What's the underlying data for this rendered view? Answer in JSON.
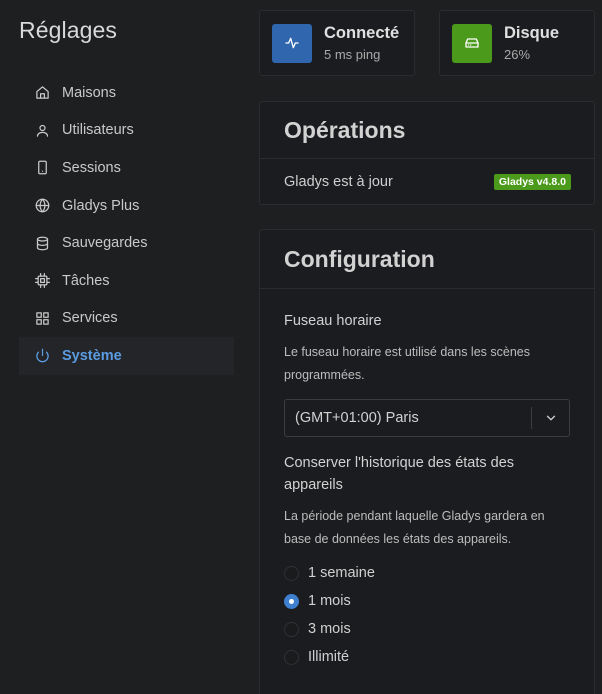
{
  "sidebar": {
    "title": "Réglages",
    "items": [
      {
        "label": "Maisons",
        "icon": "home-icon"
      },
      {
        "label": "Utilisateurs",
        "icon": "user-icon"
      },
      {
        "label": "Sessions",
        "icon": "smartphone-icon"
      },
      {
        "label": "Gladys Plus",
        "icon": "globe-icon"
      },
      {
        "label": "Sauvegardes",
        "icon": "database-icon"
      },
      {
        "label": "Tâches",
        "icon": "cpu-icon"
      },
      {
        "label": "Services",
        "icon": "grid-icon"
      },
      {
        "label": "Système",
        "icon": "power-icon",
        "active": true
      }
    ]
  },
  "stats": {
    "connection": {
      "title": "Connecté",
      "subtitle": "5 ms ping",
      "color": "#2f66ad",
      "icon": "activity-icon"
    },
    "disk": {
      "title": "Disque",
      "subtitle": "26%",
      "color": "#4c9a1c",
      "icon": "hard-drive-icon"
    }
  },
  "operations": {
    "title": "Opérations",
    "status_text": "Gladys est à jour",
    "version_badge": "Gladys v4.8.0",
    "badge_color": "#4c9a1c"
  },
  "configuration": {
    "title": "Configuration",
    "timezone": {
      "label": "Fuseau horaire",
      "help": "Le fuseau horaire est utilisé dans les scènes programmées.",
      "value": "(GMT+01:00) Paris"
    },
    "history": {
      "label": "Conserver l'historique des états des appareils",
      "help": "La période pendant laquelle Gladys gardera en base de données les états des appareils.",
      "options": [
        {
          "label": "1 semaine",
          "checked": false
        },
        {
          "label": "1 mois",
          "checked": true
        },
        {
          "label": "3 mois",
          "checked": false
        },
        {
          "label": "Illimité",
          "checked": false
        }
      ]
    }
  },
  "accent_color": "#5b9ce0"
}
